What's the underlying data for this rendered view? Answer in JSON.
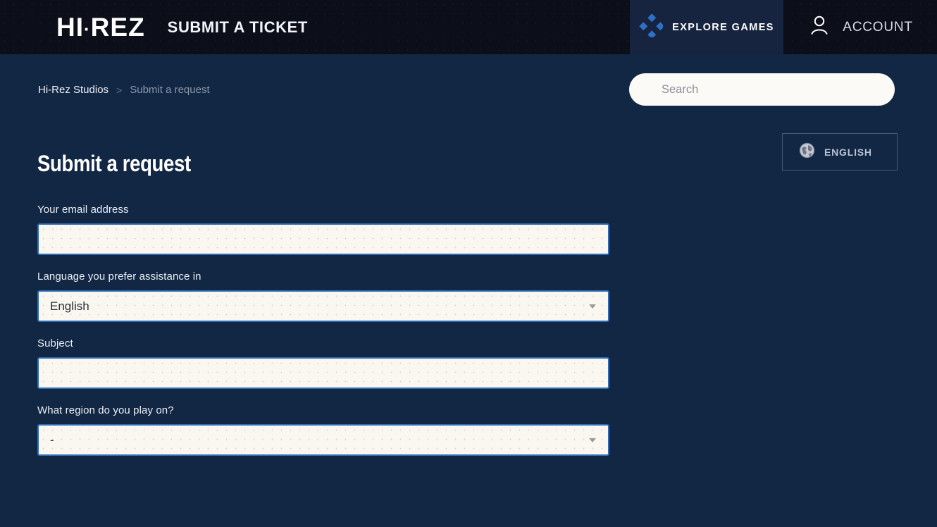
{
  "header": {
    "logo_left": "HI",
    "logo_dot": "·",
    "logo_right": "REZ",
    "site_title": "SUBMIT A TICKET",
    "explore_label": "EXPLORE GAMES",
    "explore_icon": "diamond-cluster-icon",
    "account_label": "ACCOUNT",
    "account_icon": "user-icon",
    "bar_color": "#0c0e19",
    "explore_bg": "#16243f"
  },
  "breadcrumb": {
    "root": "Hi-Rez Studios",
    "separator": ">",
    "current": "Submit a request"
  },
  "search": {
    "value": "",
    "placeholder": "Search"
  },
  "language_selector": {
    "label": "ENGLISH",
    "icon": "globe-icon"
  },
  "page": {
    "title": "Submit a request",
    "background": "#122744"
  },
  "form": {
    "fields": [
      {
        "label": "Your email address",
        "type": "text",
        "value": "",
        "placeholder": ""
      },
      {
        "label": "Language you prefer assistance in",
        "type": "select",
        "value": "English"
      },
      {
        "label": "Subject",
        "type": "text",
        "value": "",
        "placeholder": ""
      },
      {
        "label": "What region do you play on?",
        "type": "select",
        "value": "-"
      }
    ],
    "input_border_color": "#2f6bb5",
    "input_fill_color": "#faf7f0"
  }
}
